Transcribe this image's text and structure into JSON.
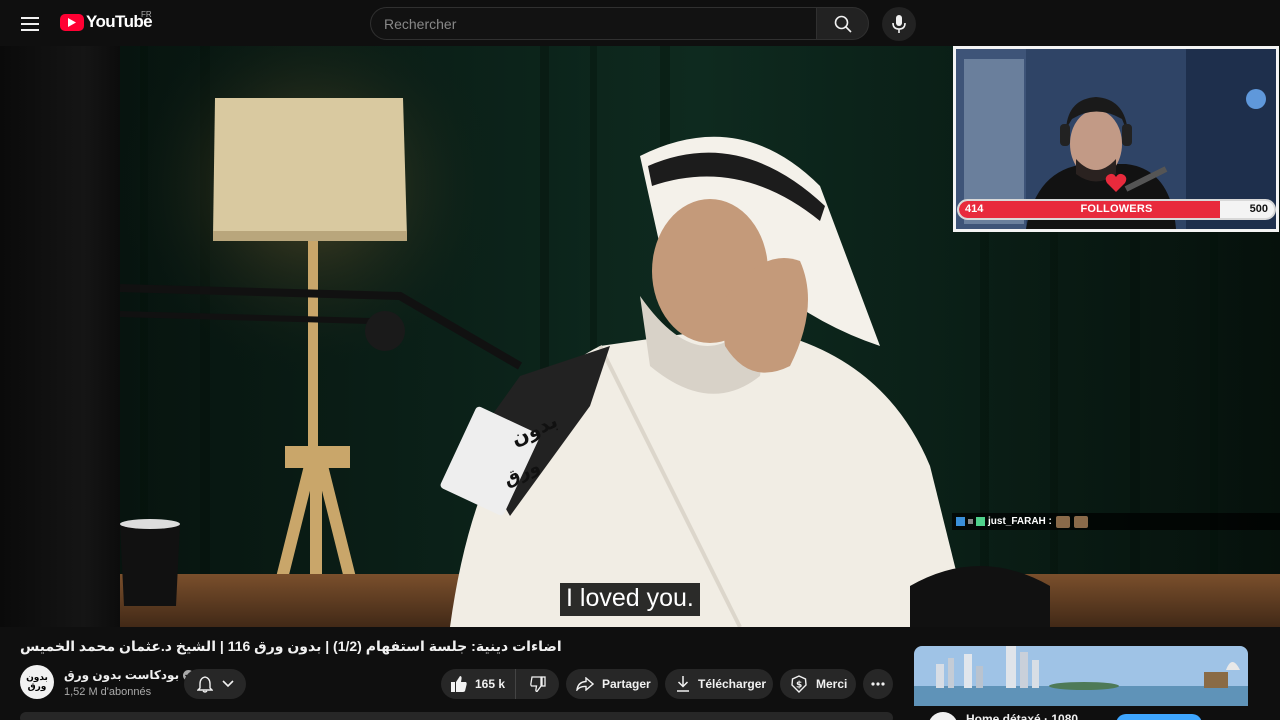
{
  "header": {
    "logo_text": "YouTube",
    "country_code": "FR",
    "search_placeholder": "Rechercher",
    "icons": [
      "menu-icon",
      "search-icon",
      "microphone-icon"
    ]
  },
  "player": {
    "subtitle": "I loved you.",
    "mic_label_line1": "بدون",
    "mic_label_line2": "ورق"
  },
  "overlay": {
    "followers_current": "414",
    "followers_label": "FOLLOWERS",
    "followers_goal": "500",
    "followers_progress": 0.828,
    "chat_user": "just_FARAH :",
    "accent_color": "#e82a3c"
  },
  "video": {
    "title": "اضاءات دينية: جلسة استفهام (1/2) | بدون ورق 116 | الشيخ د.عثمان محمد الخميس",
    "channel_name": "بودكاست بدون ورق",
    "channel_avatar_text_1": "بدون",
    "channel_avatar_text_2": "ورق",
    "subscribers": "1,52 M d'abonnés"
  },
  "actions": {
    "likes": "165 k",
    "share": "Partager",
    "download": "Télécharger",
    "thanks": "Merci"
  },
  "recommendation": {
    "title_partial": "Home détaxé · 1080"
  }
}
